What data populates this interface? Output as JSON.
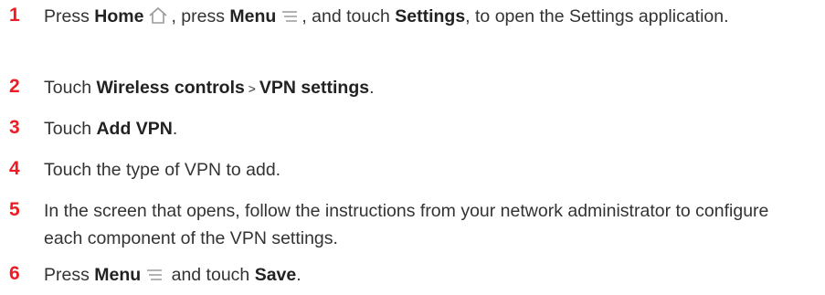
{
  "steps": [
    {
      "number": "1",
      "parts": [
        {
          "t": "Press "
        },
        {
          "t": "Home",
          "b": true
        },
        {
          "icon": "home-icon"
        },
        {
          "t": ", press "
        },
        {
          "t": "Menu",
          "b": true
        },
        {
          "icon": "menu-icon"
        },
        {
          "t": ", and touch "
        },
        {
          "t": "Settings",
          "b": true
        },
        {
          "t": ", to open the Settings application."
        }
      ]
    },
    {
      "number": "2",
      "parts": [
        {
          "t": "Touch "
        },
        {
          "t": "Wireless controls",
          "b": true
        },
        {
          "t": " > "
        },
        {
          "t": "VPN settings",
          "b": true
        },
        {
          "t": "."
        }
      ]
    },
    {
      "number": "3",
      "parts": [
        {
          "t": "Touch "
        },
        {
          "t": "Add VPN",
          "b": true
        },
        {
          "t": "."
        }
      ]
    },
    {
      "number": "4",
      "parts": [
        {
          "t": "Touch the type of VPN to add."
        }
      ]
    },
    {
      "number": "5",
      "parts": [
        {
          "t": "In the screen that opens, follow the instructions from your network administrator to configure each component of the VPN settings."
        }
      ]
    },
    {
      "number": "6",
      "parts": [
        {
          "t": "Press "
        },
        {
          "t": "Menu",
          "b": true
        },
        {
          "icon": "menu-icon"
        },
        {
          "t": " and touch "
        },
        {
          "t": "Save",
          "b": true
        },
        {
          "t": "."
        }
      ]
    }
  ],
  "colors": {
    "step_number": "#ee1c24",
    "text": "#333333"
  }
}
